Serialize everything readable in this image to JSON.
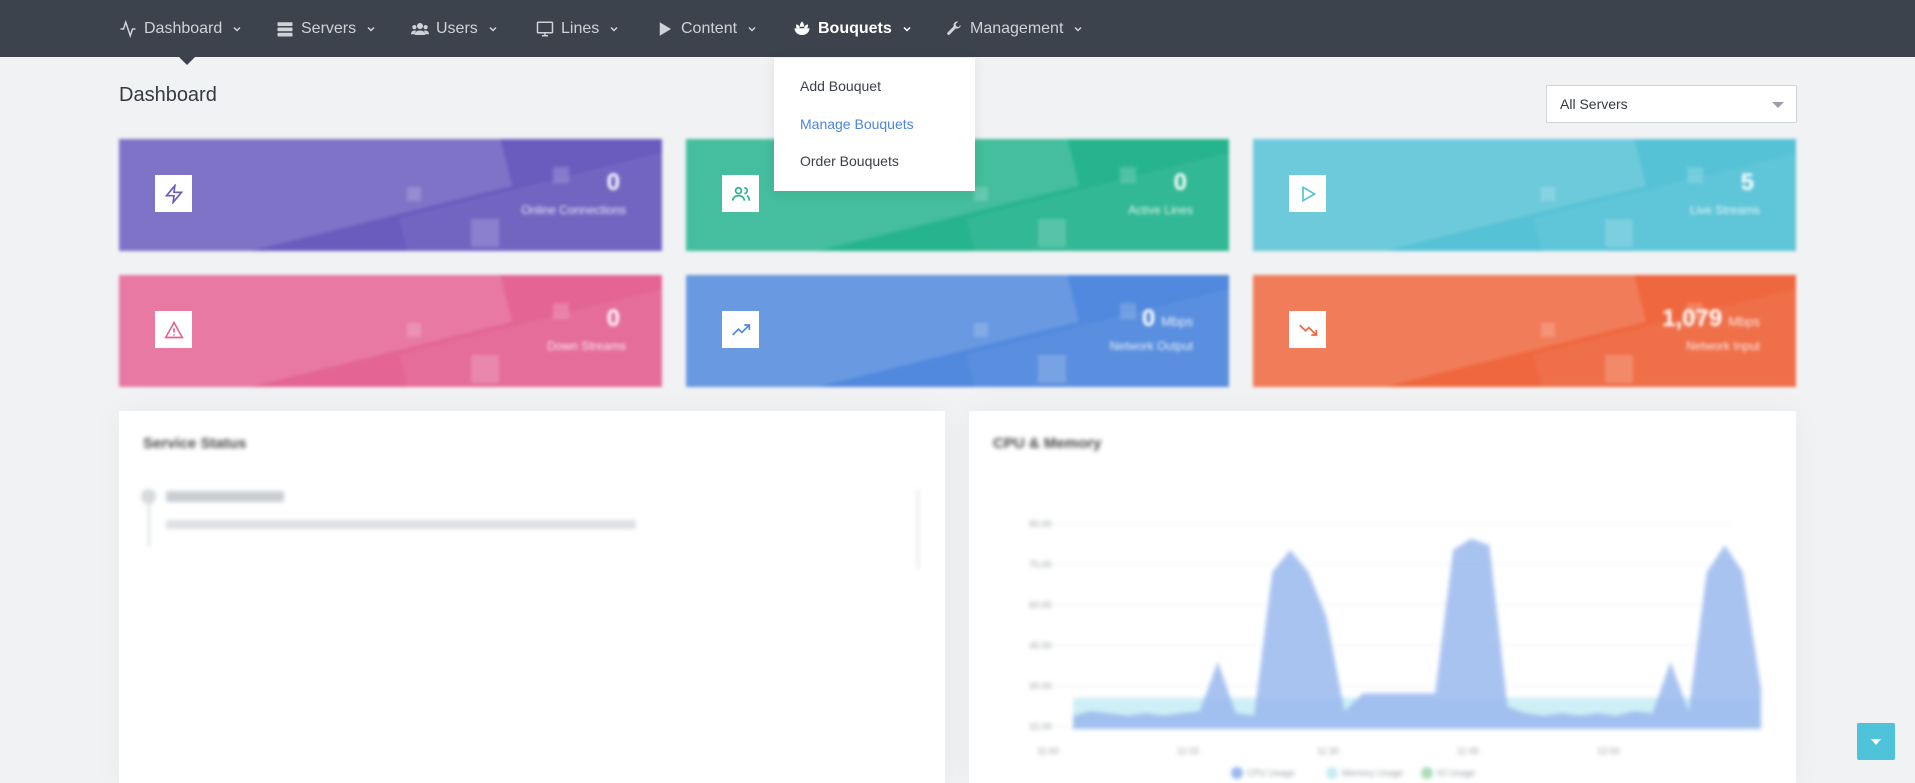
{
  "nav": {
    "items": [
      {
        "label": "Dashboard",
        "icon": "activity-icon",
        "active": false
      },
      {
        "label": "Servers",
        "icon": "server-icon",
        "active": false
      },
      {
        "label": "Users",
        "icon": "users-icon",
        "active": false
      },
      {
        "label": "Lines",
        "icon": "monitor-icon",
        "active": false
      },
      {
        "label": "Content",
        "icon": "play-icon",
        "active": false
      },
      {
        "label": "Bouquets",
        "icon": "bouquet-icon",
        "active": true
      },
      {
        "label": "Management",
        "icon": "wrench-icon",
        "active": false
      }
    ]
  },
  "page": {
    "title": "Dashboard"
  },
  "server_select": {
    "value": "All Servers"
  },
  "bouquets_menu": {
    "items": [
      {
        "label": "Add Bouquet",
        "active": false
      },
      {
        "label": "Manage Bouquets",
        "active": true
      },
      {
        "label": "Order Bouquets",
        "active": false
      }
    ]
  },
  "widgets": [
    {
      "value": "0",
      "unit": "",
      "label": "Online Connections",
      "icon": "lightning-icon",
      "color": "#6a5cbf"
    },
    {
      "value": "0",
      "unit": "",
      "label": "Active Lines",
      "icon": "users-icon",
      "color": "#26b48e"
    },
    {
      "value": "5",
      "unit": "",
      "label": "Live Streams",
      "icon": "play-outline-icon",
      "color": "#56c2d6"
    },
    {
      "value": "0",
      "unit": "",
      "label": "Down Streams",
      "icon": "warning-icon",
      "color": "#e46494"
    },
    {
      "value": "0",
      "unit": "Mbps",
      "label": "Network Output",
      "icon": "trending-up-icon",
      "color": "#5089dd"
    },
    {
      "value": "1,079",
      "unit": "Mbps",
      "label": "Network Input",
      "icon": "trending-down-icon",
      "color": "#ef673e"
    }
  ],
  "panels": {
    "service_status": {
      "title": "Service Status"
    },
    "cpu_memory": {
      "title": "CPU & Memory"
    }
  },
  "chart_data": {
    "type": "area",
    "title": "CPU & Memory",
    "ylim": [
      0,
      100
    ],
    "y_ticks": [
      "90.00",
      "75.00",
      "60.00",
      "45.00",
      "30.00",
      "15.00"
    ],
    "x_ticks": [
      "11:00",
      "11:15",
      "11:30",
      "11:45",
      "12:00"
    ],
    "series": [
      {
        "name": "CPU Usage",
        "color": "#9ab8ee",
        "values": [
          6,
          8,
          7,
          6,
          7,
          6,
          7,
          8,
          30,
          7,
          6,
          70,
          80,
          70,
          50,
          8,
          16,
          16,
          16,
          16,
          16,
          80,
          85,
          82,
          10,
          7,
          6,
          7,
          6,
          7,
          6,
          8,
          7,
          30,
          8,
          70,
          82,
          70,
          18
        ]
      },
      {
        "name": "Memory Usage",
        "color": "#c6ecf3",
        "values": [
          14,
          14,
          14,
          14,
          14,
          14,
          14,
          14,
          14,
          14,
          14,
          14,
          14,
          14,
          14,
          14,
          14,
          14,
          14,
          14,
          14,
          14,
          14,
          14,
          14,
          14,
          14,
          14,
          14,
          14,
          14,
          14,
          14,
          14,
          14,
          14,
          14,
          14,
          14
        ]
      },
      {
        "name": "IO Usage",
        "color": "#a9dcb7",
        "values": [
          0,
          0,
          0,
          0,
          0,
          0,
          0,
          0,
          0,
          0,
          0,
          0,
          0,
          0,
          0,
          0,
          0,
          0,
          0,
          0,
          0,
          0,
          0,
          0,
          0,
          0,
          0,
          0,
          0,
          0,
          0,
          0,
          0,
          0,
          0,
          0,
          0,
          0,
          0
        ]
      }
    ],
    "legend": "bottom"
  }
}
